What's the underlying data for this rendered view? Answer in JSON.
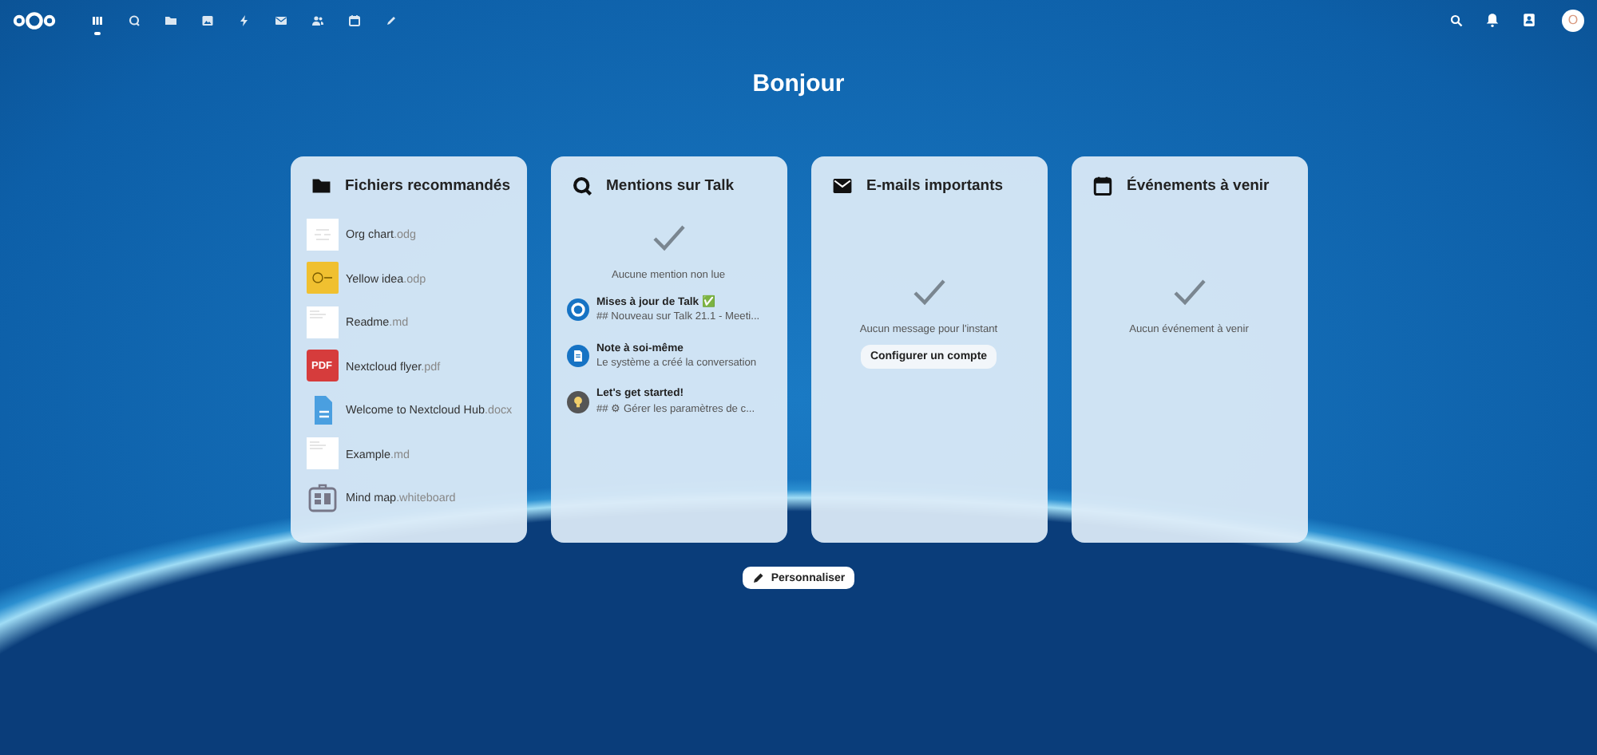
{
  "header": {
    "apps": [
      {
        "kind": "dashboard",
        "selected": true
      },
      {
        "kind": "talk",
        "selected": false
      },
      {
        "kind": "files",
        "selected": false
      },
      {
        "kind": "photos",
        "selected": false
      },
      {
        "kind": "activity",
        "selected": false
      },
      {
        "kind": "mail",
        "selected": false
      },
      {
        "kind": "contacts",
        "selected": false
      },
      {
        "kind": "calendar",
        "selected": false
      },
      {
        "kind": "notes",
        "selected": false
      }
    ],
    "avatar": "O"
  },
  "greeting": "Bonjour",
  "widgets": [
    {
      "kind": "files",
      "title": "Fichiers recommandés",
      "items": [
        {
          "name": "Org chart",
          "ext": ".odg",
          "kind": "chart"
        },
        {
          "name": "Yellow idea",
          "ext": ".odp",
          "kind": "yellow"
        },
        {
          "name": "Readme",
          "ext": ".md",
          "kind": "page"
        },
        {
          "name": "Nextcloud flyer",
          "ext": ".pdf",
          "kind": "pdf",
          "badge": "PDF"
        },
        {
          "name": "Welcome to Nextcloud Hub",
          "ext": ".docx",
          "kind": "doc"
        },
        {
          "name": "Example",
          "ext": ".md",
          "kind": "page"
        },
        {
          "name": "Mind map",
          "ext": ".whiteboard",
          "kind": "whiteboard"
        }
      ]
    },
    {
      "kind": "talk",
      "title": "Mentions sur Talk",
      "empty": "Aucune mention non lue",
      "items": [
        {
          "title": "Mises à jour de Talk ✅",
          "subtitle": "## Nouveau sur Talk 21.1 - Meeti...",
          "kind": "talk"
        },
        {
          "title": "Note à soi-même",
          "subtitle": "Le système a créé la conversation",
          "kind": "note"
        },
        {
          "title": "Let's get started!",
          "subtitle": "## ⚙ Gérer les paramètres de c...",
          "kind": "bulb"
        }
      ]
    },
    {
      "kind": "mail",
      "title": "E-mails importants",
      "empty": "Aucun message pour l'instant",
      "button": "Configurer un compte"
    },
    {
      "kind": "calendar",
      "title": "Événements à venir",
      "empty": "Aucun événement à venir"
    }
  ],
  "customize": "Personnaliser"
}
